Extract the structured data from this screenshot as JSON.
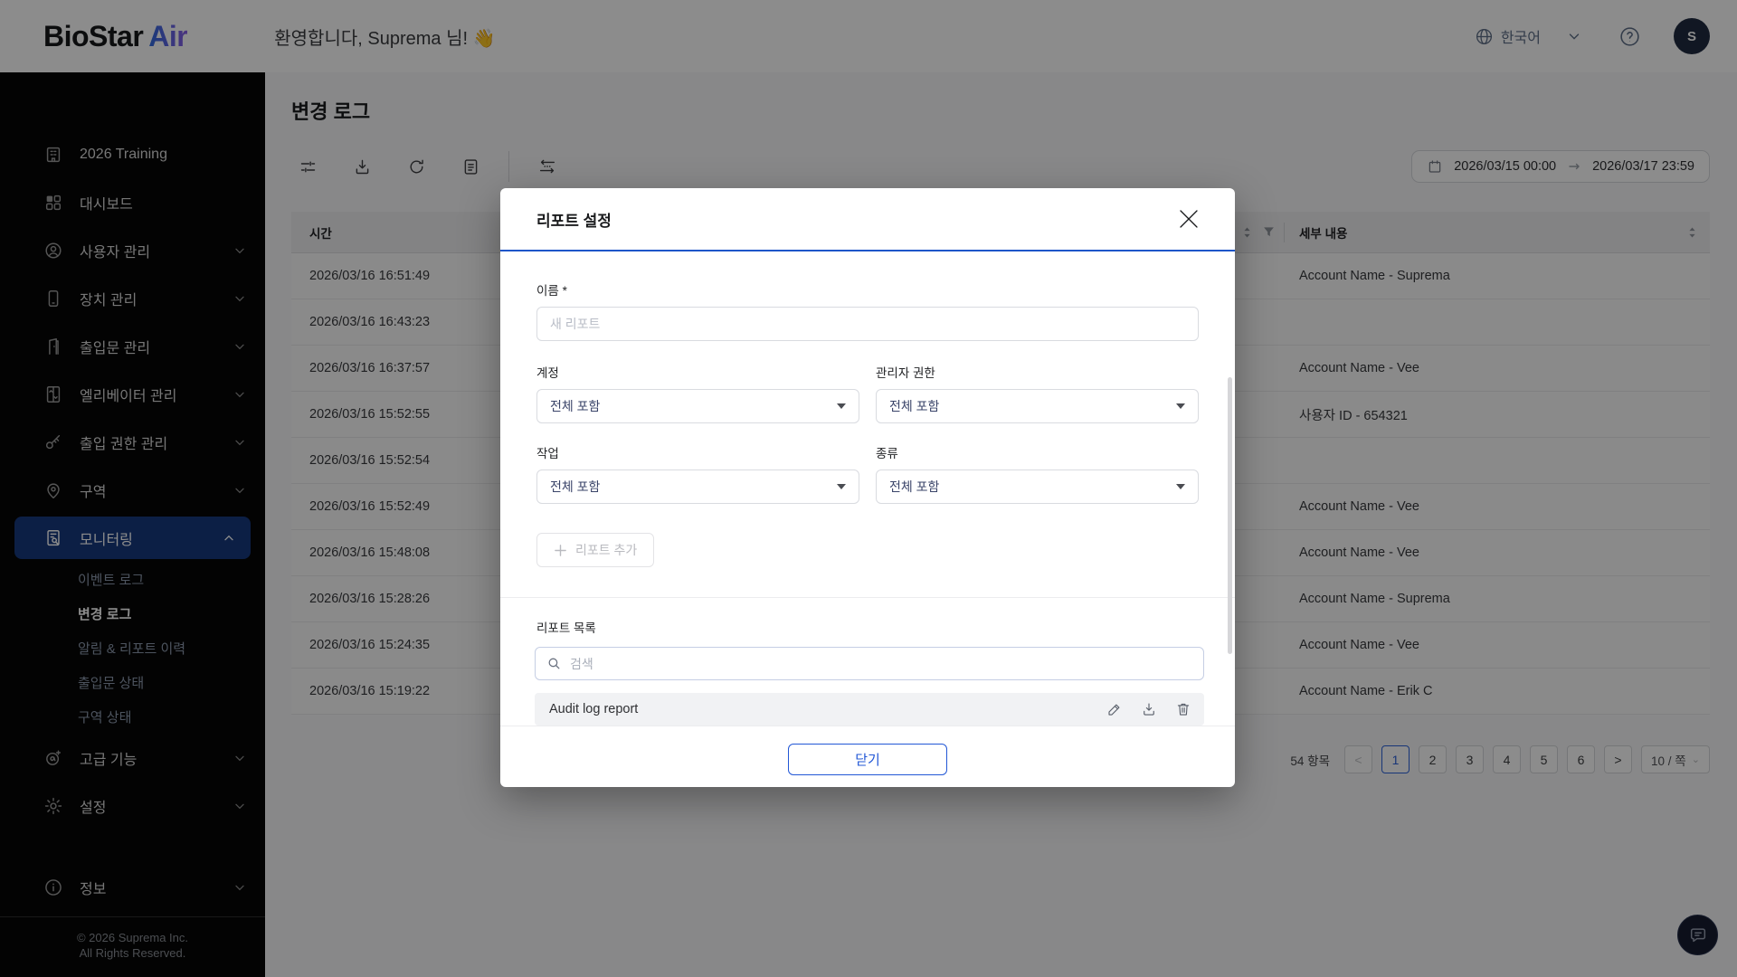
{
  "header": {
    "logo_primary": "BioStar",
    "logo_accent": "Air",
    "welcome": "환영합니다, Suprema 님! 👋",
    "language": "한국어",
    "avatar_initial": "S"
  },
  "sidebar": {
    "items": [
      {
        "label": "2026 Training"
      },
      {
        "label": "대시보드"
      },
      {
        "label": "사용자 관리"
      },
      {
        "label": "장치 관리"
      },
      {
        "label": "출입문 관리"
      },
      {
        "label": "엘리베이터 관리"
      },
      {
        "label": "출입 권한 관리"
      },
      {
        "label": "구역"
      },
      {
        "label": "모니터링"
      },
      {
        "label": "고급 기능"
      },
      {
        "label": "설정"
      },
      {
        "label": "정보"
      }
    ],
    "monitoring_submenu": [
      {
        "label": "이벤트 로그"
      },
      {
        "label": "변경 로그"
      },
      {
        "label": "알림 & 리포트 이력"
      },
      {
        "label": "출입문 상태"
      },
      {
        "label": "구역 상태"
      }
    ],
    "footer_line1": "© 2026 Suprema Inc.",
    "footer_line2": "All Rights Reserved."
  },
  "page": {
    "title": "변경 로그",
    "date_start": "2026/03/15 00:00",
    "date_end": "2026/03/17 23:59"
  },
  "table": {
    "columns": {
      "time": "시간",
      "detail": "세부 내용"
    },
    "rows": [
      {
        "time": "2026/03/16 16:51:49",
        "detail": "Account Name - Suprema"
      },
      {
        "time": "2026/03/16 16:43:23",
        "detail": ""
      },
      {
        "time": "2026/03/16 16:37:57",
        "detail": "Account Name - Vee"
      },
      {
        "time": "2026/03/16 15:52:55",
        "detail": "사용자 ID - 654321"
      },
      {
        "time": "2026/03/16 15:52:54",
        "detail": ""
      },
      {
        "time": "2026/03/16 15:52:49",
        "detail": "Account Name - Vee"
      },
      {
        "time": "2026/03/16 15:48:08",
        "detail": "Account Name - Vee"
      },
      {
        "time": "2026/03/16 15:28:26",
        "detail": "Account Name - Suprema"
      },
      {
        "time": "2026/03/16 15:24:35",
        "detail": "Account Name - Vee"
      },
      {
        "time": "2026/03/16 15:19:22",
        "detail": "Account Name - Erik C"
      }
    ]
  },
  "pagination": {
    "total": "54 항목",
    "pages": [
      "1",
      "2",
      "3",
      "4",
      "5",
      "6"
    ],
    "active_page": "1",
    "page_size": "10 / 쪽"
  },
  "modal": {
    "title": "리포트 설정",
    "name_label": "이름 *",
    "name_placeholder": "새 리포트",
    "fields": [
      {
        "label": "계정",
        "value": "전체 포함"
      },
      {
        "label": "관리자 권한",
        "value": "전체 포함"
      },
      {
        "label": "작업",
        "value": "전체 포함"
      },
      {
        "label": "종류",
        "value": "전체 포함"
      }
    ],
    "add_button": "리포트 추가",
    "list_label": "리포트 목록",
    "search_placeholder": "검색",
    "list_items": [
      {
        "name": "Audit log report"
      }
    ],
    "close_button": "닫기"
  },
  "colors": {
    "accent_blue": "#1e56c9",
    "active_nav_bg": "#16397f",
    "sidebar_bg": "#060606"
  }
}
